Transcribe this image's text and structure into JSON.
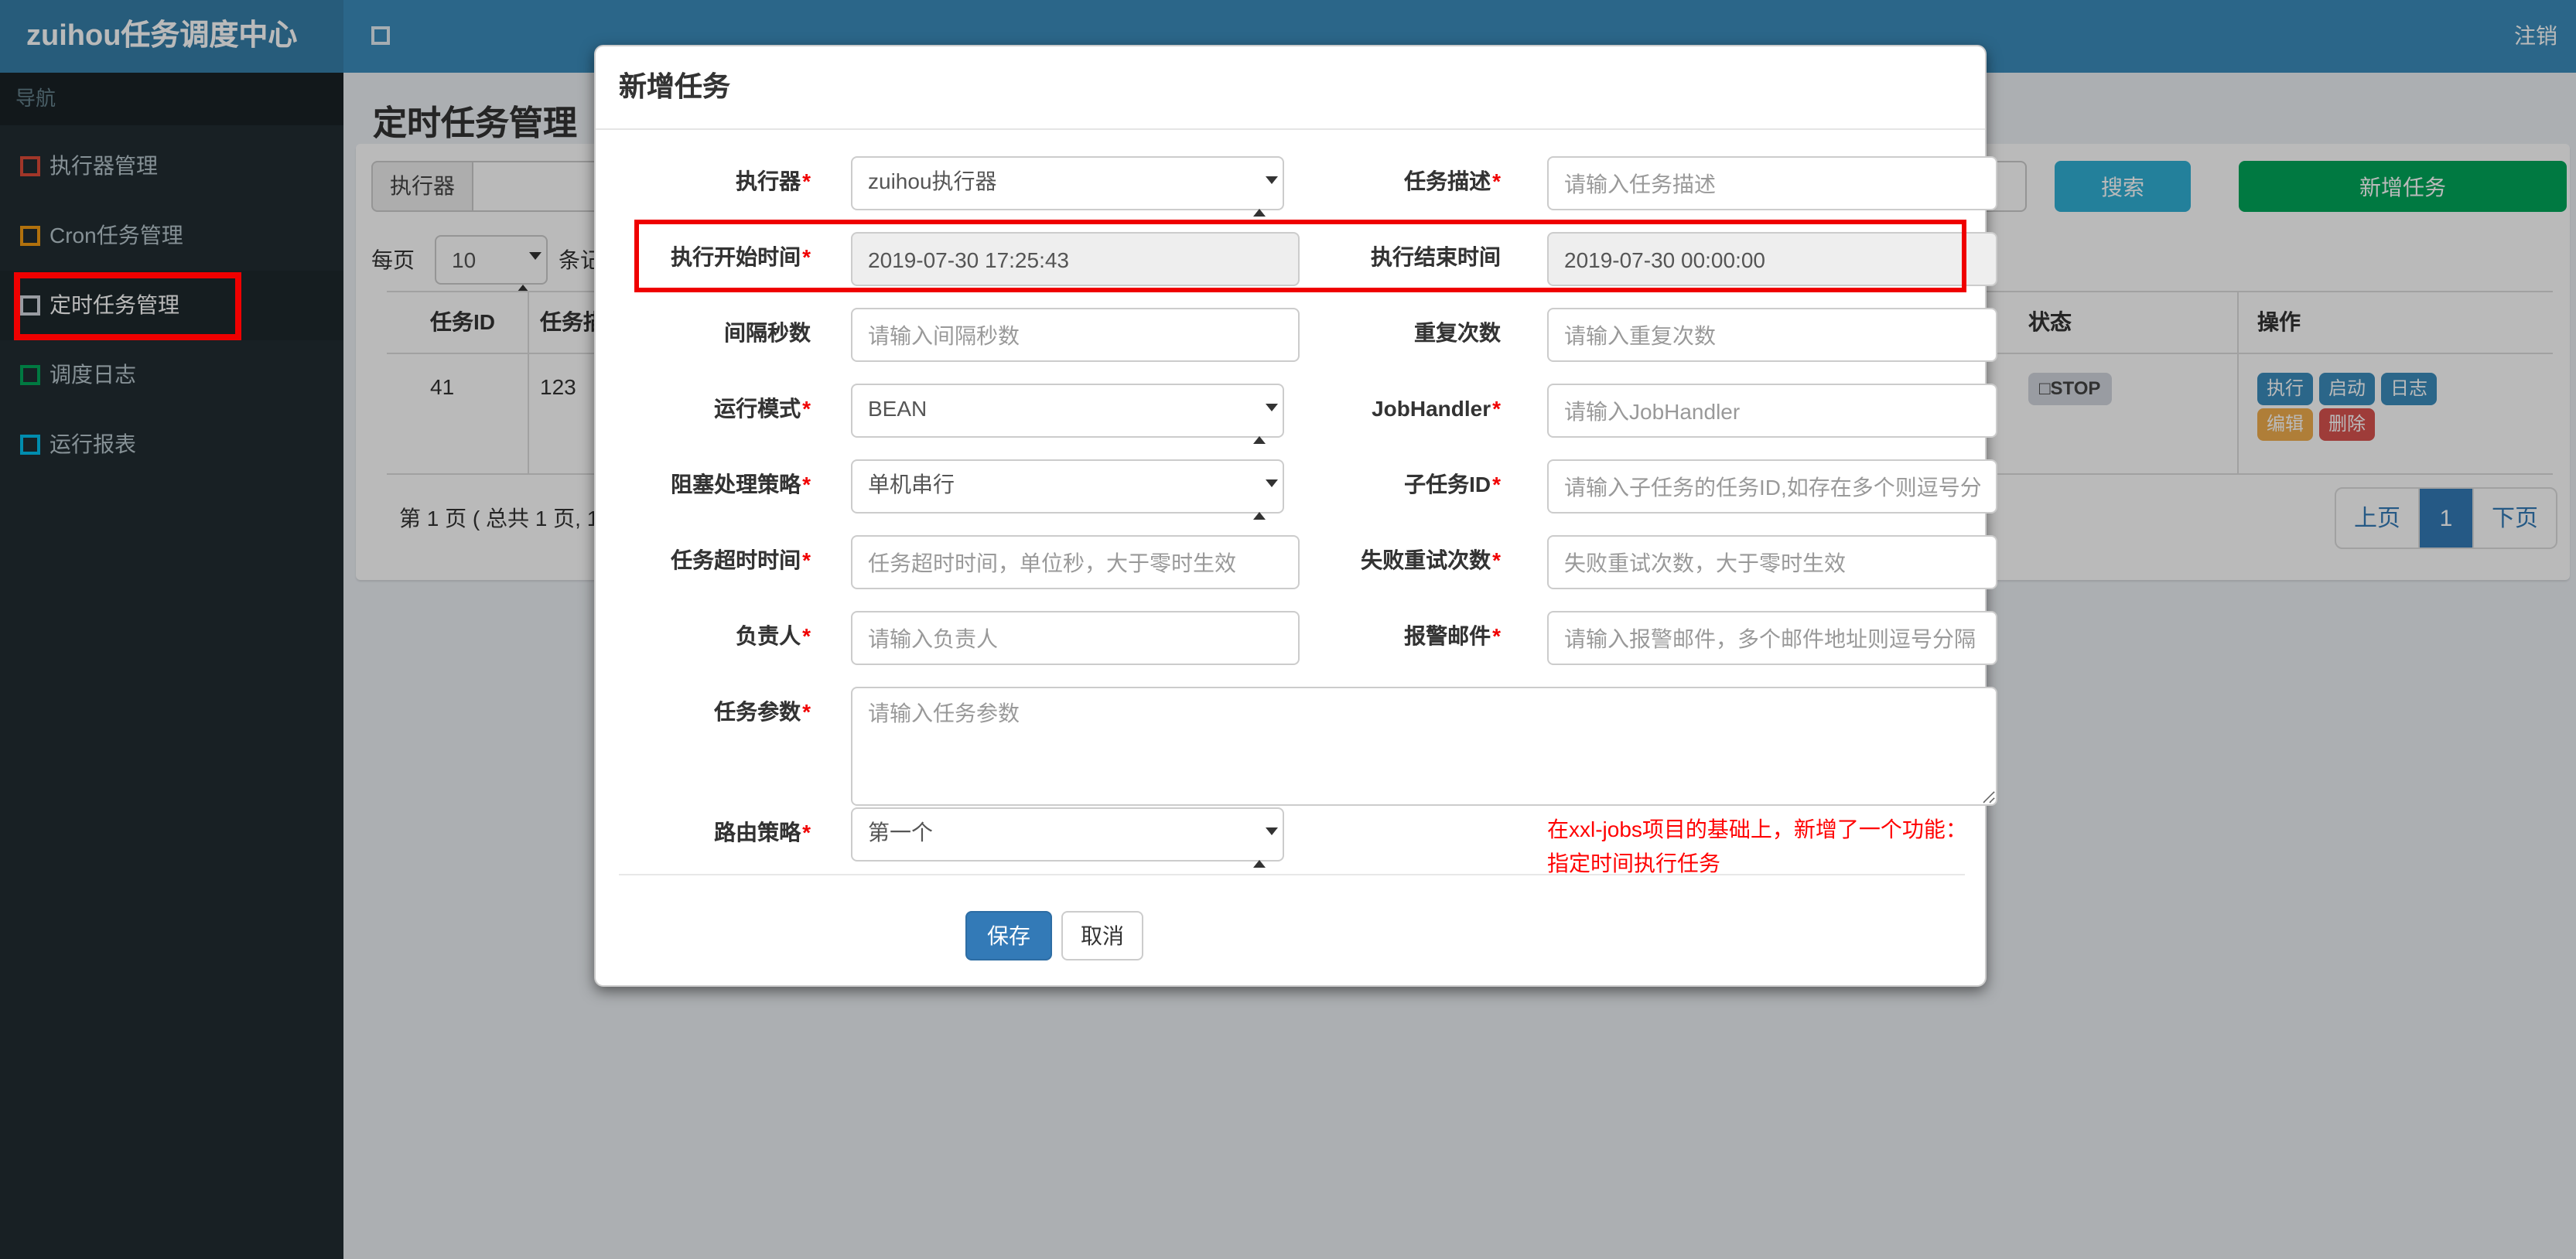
{
  "navbar": {
    "brand": "zuihou任务调度中心",
    "logout": "注销"
  },
  "sidebar": {
    "section_header": "导航",
    "items": [
      {
        "label": "执行器管理",
        "icon": "square-outline-icon",
        "icon_color": "#dd4b39",
        "active": false
      },
      {
        "label": "Cron任务管理",
        "icon": "square-outline-icon",
        "icon_color": "#f39c12",
        "active": false
      },
      {
        "label": "定时任务管理",
        "icon": "square-outline-icon",
        "icon_color": "#d2d6de",
        "active": true
      },
      {
        "label": "调度日志",
        "icon": "square-outline-icon",
        "icon_color": "#00a65a",
        "active": false
      },
      {
        "label": "运行报表",
        "icon": "square-outline-icon",
        "icon_color": "#00c0ef",
        "active": false
      }
    ]
  },
  "page": {
    "title": "定时任务管理"
  },
  "toolbar": {
    "executor_addon": "执行器",
    "search_button": "搜索",
    "add_task_button": "新增任务",
    "per_page_prefix": "每页",
    "per_page_value": "10",
    "per_page_suffix": "条记录"
  },
  "table": {
    "headers": {
      "job_id": "任务ID",
      "job_desc": "任务描述",
      "status": "状态",
      "actions": "操作"
    },
    "row": {
      "job_id": "41",
      "job_desc": "123",
      "status_icon": "□",
      "status": "STOP"
    },
    "action_buttons": [
      {
        "label": "执行",
        "color": "#3c8dbc"
      },
      {
        "label": "启动",
        "color": "#3c8dbc"
      },
      {
        "label": "日志",
        "color": "#3c8dbc"
      },
      {
        "label": "编辑",
        "color": "#f0ad4e"
      },
      {
        "label": "删除",
        "color": "#d9534f"
      }
    ],
    "summary": "第 1 页 ( 总共 1 页, 1",
    "pagination": {
      "prev": "上页",
      "current": "1",
      "next": "下页"
    }
  },
  "modal": {
    "title": "新增任务",
    "required_mark": "*",
    "fields": {
      "executor": {
        "label": "执行器",
        "type": "select",
        "value": "zuihou执行器"
      },
      "job_desc": {
        "label": "任务描述",
        "type": "input",
        "placeholder": "请输入任务描述"
      },
      "start_time": {
        "label": "执行开始时间",
        "type": "readonly",
        "value": "2019-07-30 17:25:43"
      },
      "end_time": {
        "label": "执行结束时间",
        "type": "readonly",
        "value": "2019-07-30 00:00:00"
      },
      "interval_sec": {
        "label": "间隔秒数",
        "type": "input",
        "placeholder": "请输入间隔秒数"
      },
      "repeat_count": {
        "label": "重复次数",
        "type": "input",
        "placeholder": "请输入重复次数"
      },
      "run_mode": {
        "label": "运行模式",
        "type": "select",
        "value": "BEAN"
      },
      "job_handler": {
        "label": "JobHandler",
        "type": "input",
        "placeholder": "请输入JobHandler"
      },
      "block_strategy": {
        "label": "阻塞处理策略",
        "type": "select",
        "value": "单机串行"
      },
      "child_job_id": {
        "label": "子任务ID",
        "type": "input",
        "placeholder": "请输入子任务的任务ID,如存在多个则逗号分隔"
      },
      "timeout": {
        "label": "任务超时时间",
        "type": "input",
        "placeholder": "任务超时时间，单位秒，大于零时生效"
      },
      "fail_retry": {
        "label": "失败重试次数",
        "type": "input",
        "placeholder": "失败重试次数，大于零时生效"
      },
      "owner": {
        "label": "负责人",
        "type": "input",
        "placeholder": "请输入负责人"
      },
      "alarm_email": {
        "label": "报警邮件",
        "type": "input",
        "placeholder": "请输入报警邮件，多个邮件地址则逗号分隔"
      },
      "job_param": {
        "label": "任务参数",
        "type": "textarea",
        "placeholder": "请输入任务参数"
      },
      "route_strategy": {
        "label": "路由策略",
        "type": "select",
        "value": "第一个"
      }
    },
    "note_line1": "在xxl-jobs项目的基础上，新增了一个功能：",
    "note_line2": "指定时间执行任务",
    "save_button": "保存",
    "cancel_button": "取消"
  },
  "colors": {
    "navbar": "#3c8dbc",
    "brand_bg": "#367fa9",
    "sidebar_bg": "#222d32",
    "search_button": "#31b0d5",
    "add_button": "#00a65a",
    "save_button": "#337ab7",
    "pagination_active": "#337ab7",
    "annotation": "#ef0000",
    "note_text": "#ff0000"
  }
}
